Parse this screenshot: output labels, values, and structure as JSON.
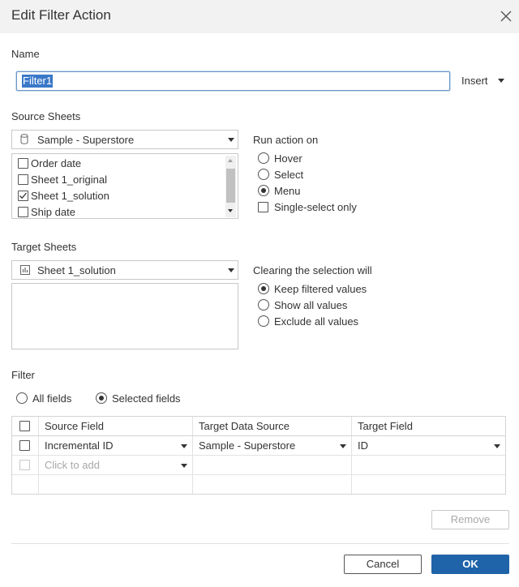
{
  "dialog": {
    "title": "Edit Filter Action"
  },
  "name_section": {
    "label": "Name",
    "value": "Filter1",
    "insert_label": "Insert"
  },
  "source": {
    "label": "Source Sheets",
    "datasource": "Sample - Superstore",
    "sheets": [
      {
        "label": "Order date",
        "checked": false
      },
      {
        "label": "Sheet 1_original",
        "checked": false
      },
      {
        "label": "Sheet 1_solution",
        "checked": true
      },
      {
        "label": "Ship date",
        "checked": false
      }
    ]
  },
  "run_action": {
    "label": "Run action on",
    "options": [
      "Hover",
      "Select",
      "Menu"
    ],
    "selected": "Menu",
    "single_select_label": "Single-select only",
    "single_select_checked": false
  },
  "target": {
    "label": "Target Sheets",
    "sheet": "Sheet 1_solution"
  },
  "clearing": {
    "label": "Clearing the selection will",
    "options": [
      "Keep filtered values",
      "Show all values",
      "Exclude all values"
    ],
    "selected": "Keep filtered values"
  },
  "filter": {
    "label": "Filter",
    "all_fields_label": "All fields",
    "selected_fields_label": "Selected fields",
    "selected": "Selected fields",
    "columns": [
      "Source Field",
      "Target Data Source",
      "Target Field"
    ],
    "rows": [
      {
        "source_field": "Incremental ID",
        "target_data_source": "Sample - Superstore",
        "target_field": "ID"
      }
    ],
    "add_placeholder": "Click to add"
  },
  "buttons": {
    "remove": "Remove",
    "cancel": "Cancel",
    "ok": "OK"
  },
  "colors": {
    "accent": "#1f63a8",
    "selection": "#3a78c8",
    "title_bar": "#f2f2f2"
  }
}
